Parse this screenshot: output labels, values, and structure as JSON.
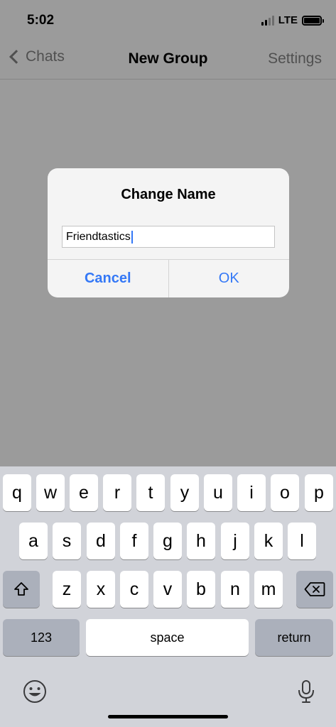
{
  "status_bar": {
    "time": "5:02",
    "network": "LTE"
  },
  "nav": {
    "back_label": "Chats",
    "title": "New Group",
    "right_label": "Settings"
  },
  "dialog": {
    "title": "Change Name",
    "input_value": "Friendtastics",
    "cancel_label": "Cancel",
    "ok_label": "OK"
  },
  "keyboard": {
    "row1": [
      "q",
      "w",
      "e",
      "r",
      "t",
      "y",
      "u",
      "i",
      "o",
      "p"
    ],
    "row2": [
      "a",
      "s",
      "d",
      "f",
      "g",
      "h",
      "j",
      "k",
      "l"
    ],
    "row3": [
      "z",
      "x",
      "c",
      "v",
      "b",
      "n",
      "m"
    ],
    "numbers_label": "123",
    "space_label": "space",
    "return_label": "return"
  },
  "colors": {
    "accent": "#3478f6",
    "dim_overlay": "#9b9b9b",
    "keyboard_bg": "#d1d3d9"
  }
}
